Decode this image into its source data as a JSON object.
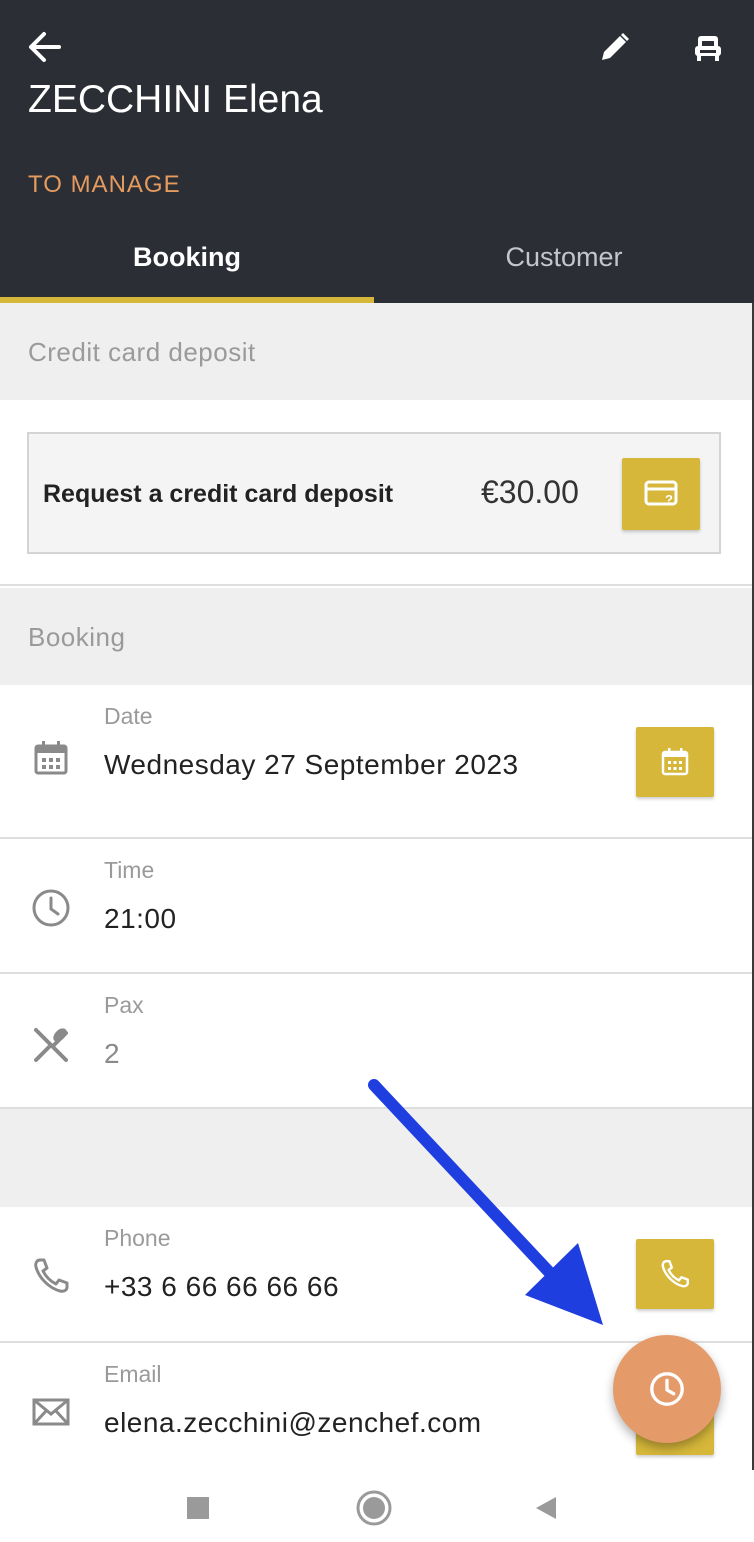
{
  "header": {
    "guest_name": "ZECCHINI Elena",
    "status": "TO MANAGE",
    "status_color": "#e59a5e",
    "background": "#2b2e35",
    "icons": {
      "back": "arrow-left-icon",
      "edit": "pencil-icon",
      "seat": "table-seat-icon"
    },
    "tabs": [
      {
        "label": "Booking",
        "active": true
      },
      {
        "label": "Customer",
        "active": false
      }
    ]
  },
  "deposit_section": {
    "title": "Credit card deposit",
    "request_label": "Request a credit card deposit",
    "amount": "€30.00",
    "button_icon": "credit-card-question-icon"
  },
  "booking_section": {
    "title": "Booking",
    "rows": [
      {
        "caption": "Date",
        "value": "Wednesday 27 September 2023",
        "icon": "calendar-icon",
        "action_icon": "calendar-icon"
      },
      {
        "caption": "Time",
        "value": "21:00",
        "icon": "clock-icon"
      },
      {
        "caption": "Pax",
        "value": "2",
        "icon": "cutlery-icon"
      }
    ]
  },
  "contact_section": {
    "rows": [
      {
        "caption": "Phone",
        "value": "+33 6 66 66 66 66",
        "icon": "phone-icon",
        "action_icon": "phone-icon"
      },
      {
        "caption": "Email",
        "value": "elena.zecchini@zenchef.com",
        "icon": "envelope-icon"
      }
    ]
  },
  "fab": {
    "icon": "clock-icon",
    "color": "#e59a6a"
  },
  "accent_color": "#d6b73a",
  "annotation_color": "#1f3ee0",
  "navbar": {
    "buttons": [
      "recent-apps-icon",
      "home-icon",
      "back-triangle-icon"
    ]
  }
}
